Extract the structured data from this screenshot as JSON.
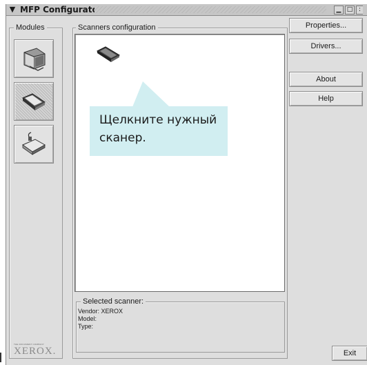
{
  "window": {
    "title": "MFP Configurator",
    "menu_icon": "chevron-down-icon",
    "controls": [
      "minimize-icon",
      "maximize-icon",
      "close-icon"
    ]
  },
  "modules": {
    "label": "Modules",
    "items": [
      {
        "name": "printers",
        "icon": "printer-icon",
        "selected": false
      },
      {
        "name": "scanners",
        "icon": "scanner-icon",
        "selected": true
      },
      {
        "name": "ports",
        "icon": "port-icon",
        "selected": false
      }
    ],
    "brand_tagline": "THE DOCUMENT COMPANY",
    "brand": "XEROX."
  },
  "scanners_config": {
    "label": "Scanners configuration",
    "scanner_icon": "scanner-icon"
  },
  "selected_scanner": {
    "label": "Selected scanner:",
    "vendor": "Vendor: XEROX",
    "model": "Model:",
    "type": "Type:"
  },
  "buttons": {
    "properties": "Properties...",
    "drivers": "Drivers...",
    "about": "About",
    "help": "Help",
    "exit": "Exit"
  },
  "callout": {
    "line1": "Щелкните нужный",
    "line2": "сканер.",
    "color": "#d1eef1"
  }
}
